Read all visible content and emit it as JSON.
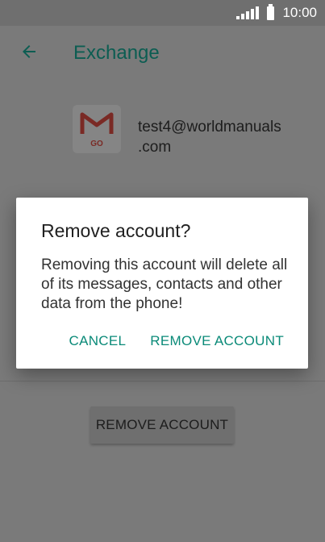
{
  "status_bar": {
    "time": "10:00"
  },
  "app_bar": {
    "title": "Exchange"
  },
  "account": {
    "email_line1": "test4@worldmanuals",
    "email_line2": ".com",
    "logo_badge": "GO"
  },
  "background": {
    "remove_button_label": "REMOVE ACCOUNT"
  },
  "dialog": {
    "title": "Remove account?",
    "message": "Removing this account will delete all of its messages, contacts and other data from the phone!",
    "cancel_label": "CANCEL",
    "confirm_label": "REMOVE ACCOUNT"
  },
  "colors": {
    "accent": "#0a8a78",
    "title": "#0c5d52"
  }
}
